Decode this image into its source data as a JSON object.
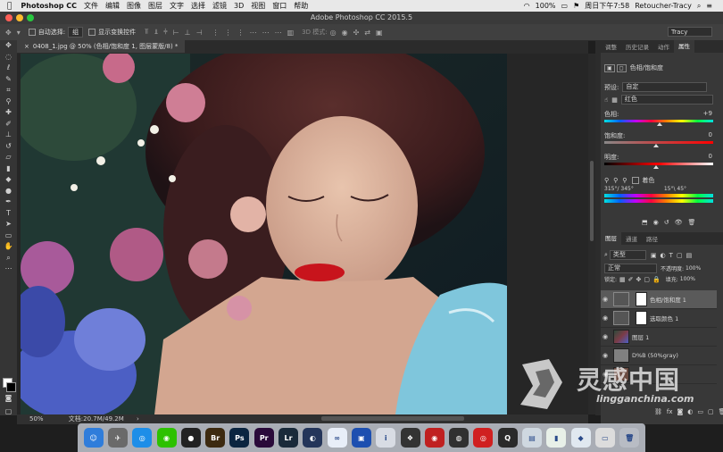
{
  "menubar": {
    "app_name": "Photoshop CC",
    "items": [
      "文件",
      "编辑",
      "图像",
      "图层",
      "文字",
      "选择",
      "滤镜",
      "3D",
      "视图",
      "窗口",
      "帮助"
    ],
    "battery": "100%",
    "clock": "周日下午7:58",
    "user": "Retoucher-Tracy"
  },
  "window": {
    "title": "Adobe Photoshop CC 2015.5"
  },
  "options_bar": {
    "auto_select_label": "自动选择:",
    "auto_select_value": "组",
    "show_transform_label": "显示变换控件",
    "mode_3d_label": "3D 模式:",
    "workspace": "Tracy"
  },
  "document": {
    "tab_label": "0408_1.jpg @ 50% (色相/饱和度 1, 图层蒙版/8) *",
    "zoom": "50%",
    "doc_size": "文档:20.7M/49.2M"
  },
  "properties_panel": {
    "tabs": [
      "调整",
      "历史记录",
      "动作",
      "属性"
    ],
    "active_tab": "属性",
    "header": "色相/饱和度",
    "preset_label": "预设:",
    "preset_value": "自定",
    "channel_value": "红色",
    "hue_label": "色相:",
    "hue_value": "+9",
    "saturation_label": "饱和度:",
    "saturation_value": "0",
    "lightness_label": "明度:",
    "lightness_value": "0",
    "colorize_label": "着色",
    "range_left": "315°/ 345°",
    "range_right": "15°\\ 45°"
  },
  "layers_panel": {
    "tabs": [
      "图层",
      "通道",
      "路径"
    ],
    "filter_label": "类型",
    "blend_mode": "正常",
    "opacity_label": "不透明度:",
    "opacity_value": "100%",
    "lock_label": "锁定:",
    "fill_label": "填充:",
    "fill_value": "100%",
    "layers": [
      {
        "name": "色相/饱和度 1",
        "selected": true
      },
      {
        "name": "选取颜色 1",
        "selected": false
      },
      {
        "name": "图层 1",
        "selected": false
      },
      {
        "name": "D%B (50%gray)",
        "selected": false
      }
    ]
  },
  "dock": {
    "apps": [
      {
        "name": "Finder",
        "glyph": "☺",
        "color": "#2f7ddb"
      },
      {
        "name": "Launchpad",
        "glyph": "✈",
        "color": "#6a6a6a"
      },
      {
        "name": "Safari",
        "glyph": "◎",
        "color": "#1d8ee8"
      },
      {
        "name": "WeChat",
        "glyph": "◉",
        "color": "#2dc100"
      },
      {
        "name": "QQ",
        "glyph": "●",
        "color": "#222222"
      },
      {
        "name": "Bridge",
        "glyph": "Br",
        "color": "#3d2a10"
      },
      {
        "name": "Photoshop",
        "glyph": "Ps",
        "color": "#0b2540"
      },
      {
        "name": "Premiere",
        "glyph": "Pr",
        "color": "#2a0a3a"
      },
      {
        "name": "Lightroom",
        "glyph": "Lr",
        "color": "#1a2a3a"
      },
      {
        "name": "Cinema4D",
        "glyph": "◐",
        "color": "#24355a"
      },
      {
        "name": "Baidu",
        "glyph": "∞",
        "color": "#e8eef8"
      },
      {
        "name": "Movie",
        "glyph": "▣",
        "color": "#1d4fb0"
      },
      {
        "name": "Info",
        "glyph": "i",
        "color": "#d8dce4"
      },
      {
        "name": "DaVinci",
        "glyph": "❖",
        "color": "#333333"
      },
      {
        "name": "Capture",
        "glyph": "◉",
        "color": "#c02020"
      },
      {
        "name": "OBS",
        "glyph": "◍",
        "color": "#303030"
      },
      {
        "name": "NetEase",
        "glyph": "◎",
        "color": "#d02020"
      },
      {
        "name": "QuickTime",
        "glyph": "Q",
        "color": "#2a2a2a"
      },
      {
        "name": "Preview",
        "glyph": "▤",
        "color": "#cfd8e0"
      },
      {
        "name": "Stats",
        "glyph": "▮",
        "color": "#e8f0e8"
      },
      {
        "name": "Keynote",
        "glyph": "◆",
        "color": "#e0e8f0"
      },
      {
        "name": "Terminal",
        "glyph": "▭",
        "color": "#dcdcdc"
      },
      {
        "name": "Trash",
        "glyph": "🗑",
        "color": "#b8bcc4"
      }
    ]
  },
  "watermark": {
    "cn": "灵感中国",
    "en": "lingganchina.com"
  }
}
